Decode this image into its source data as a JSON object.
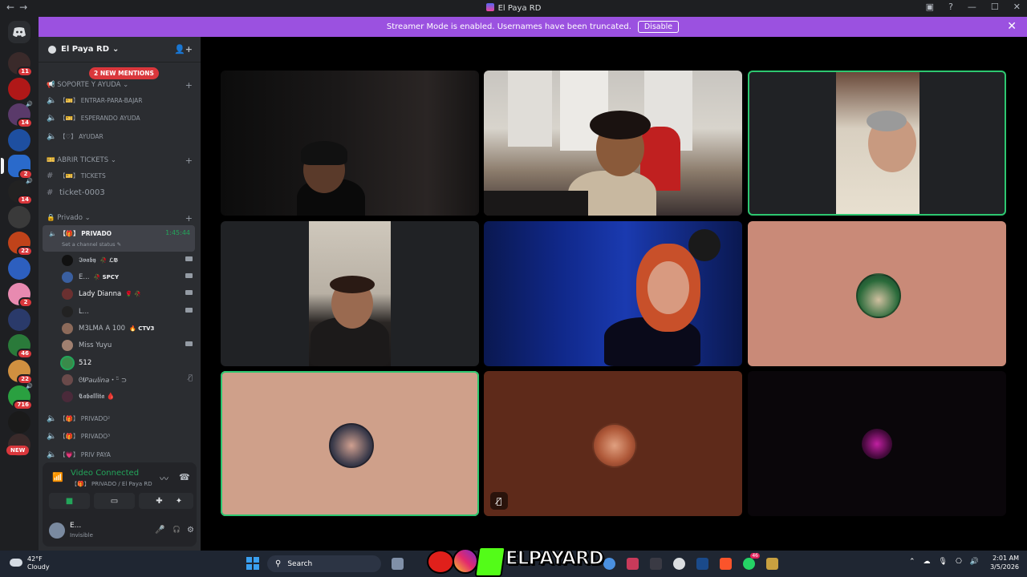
{
  "window": {
    "title": "El Paya RD",
    "back": "←",
    "forward": "→",
    "controls": [
      "▣",
      "?",
      "—",
      "☐",
      "✕"
    ]
  },
  "banner": {
    "text": "Streamer Mode is enabled. Usernames have been truncated.",
    "button": "Disable",
    "close": "✕"
  },
  "servers": {
    "badges": [
      "11",
      "14",
      "2",
      "14",
      "22",
      "2",
      "46",
      "22",
      "716"
    ],
    "new_label": "NEW"
  },
  "guild": {
    "name": "El Paya RD",
    "dropdown": "⌄",
    "mentions": "2 NEW MENTIONS"
  },
  "categories": [
    {
      "label": "📢 SOPORTE Y AYUDA ⌄"
    },
    {
      "label": "🎫 ABRIR TICKETS ⌄"
    },
    {
      "label": "🔒 Privado ⌄"
    }
  ],
  "channels": {
    "entrar": "【🎫】 ENTRAR-PARA-BAJAR",
    "esperando": "【🎫】 ESPERANDO AYUDA",
    "ayudar": "【♡】 AYUDAR",
    "tickets": "【🎫】 TICKETS",
    "ticket0003": "ticket-0003",
    "privado": "【🎁】 PRIVADO",
    "privado_timer": "1:45:44",
    "privado_status": "Set a channel status ✎",
    "privado2": "【🎁】 PRIVADO²",
    "privado3": "【🎁】 PRIVADO³",
    "privpaya": "【💗】 PRIV PAYA"
  },
  "voice_users": [
    {
      "name": "𝕴𝖛𝖆𝖇𝖞",
      "tag": "🥀 ℒ𝔅",
      "color": "#111111"
    },
    {
      "name": "E...",
      "tag": "🥀 SPCY",
      "color": "#3a5fa0"
    },
    {
      "name": "Lady Dianna",
      "tag": "🌹 🥀",
      "color": "#6a3030"
    },
    {
      "name": "L...",
      "tag": "",
      "color": "#222222"
    },
    {
      "name": "M3LMA A 100",
      "tag": "🔥 CTV3",
      "color": "#8c6a5a"
    },
    {
      "name": "Miss Yuyu",
      "tag": "",
      "color": "#a08070"
    },
    {
      "name": "512",
      "tag": "",
      "color": "#3a8a4a"
    },
    {
      "name": "ᘛ𝘗𝘢𝘶𝘭𝘪𝘯𝘢・ᵕ̈ ⊃",
      "tag": "",
      "color": "#6a4a4a"
    },
    {
      "name": "𝕮𝖆𝖇𝖆𝖑𝖑𝖎𝖙𝖆 🩸",
      "tag": "",
      "color": "#4a2a3a"
    }
  ],
  "voice_panel": {
    "status": "Video Connected",
    "channel": "【🎁】 PRIVADO / El Paya RD",
    "user_name": "E...",
    "user_status": "Invisible"
  },
  "taskbar": {
    "temp": "42°F",
    "condition": "Cloudy",
    "search": "Search",
    "time": "2:01 AM",
    "date": "3/5/2026",
    "whatsapp_badge": "46"
  },
  "overlay_logo": "ELPAYARD"
}
